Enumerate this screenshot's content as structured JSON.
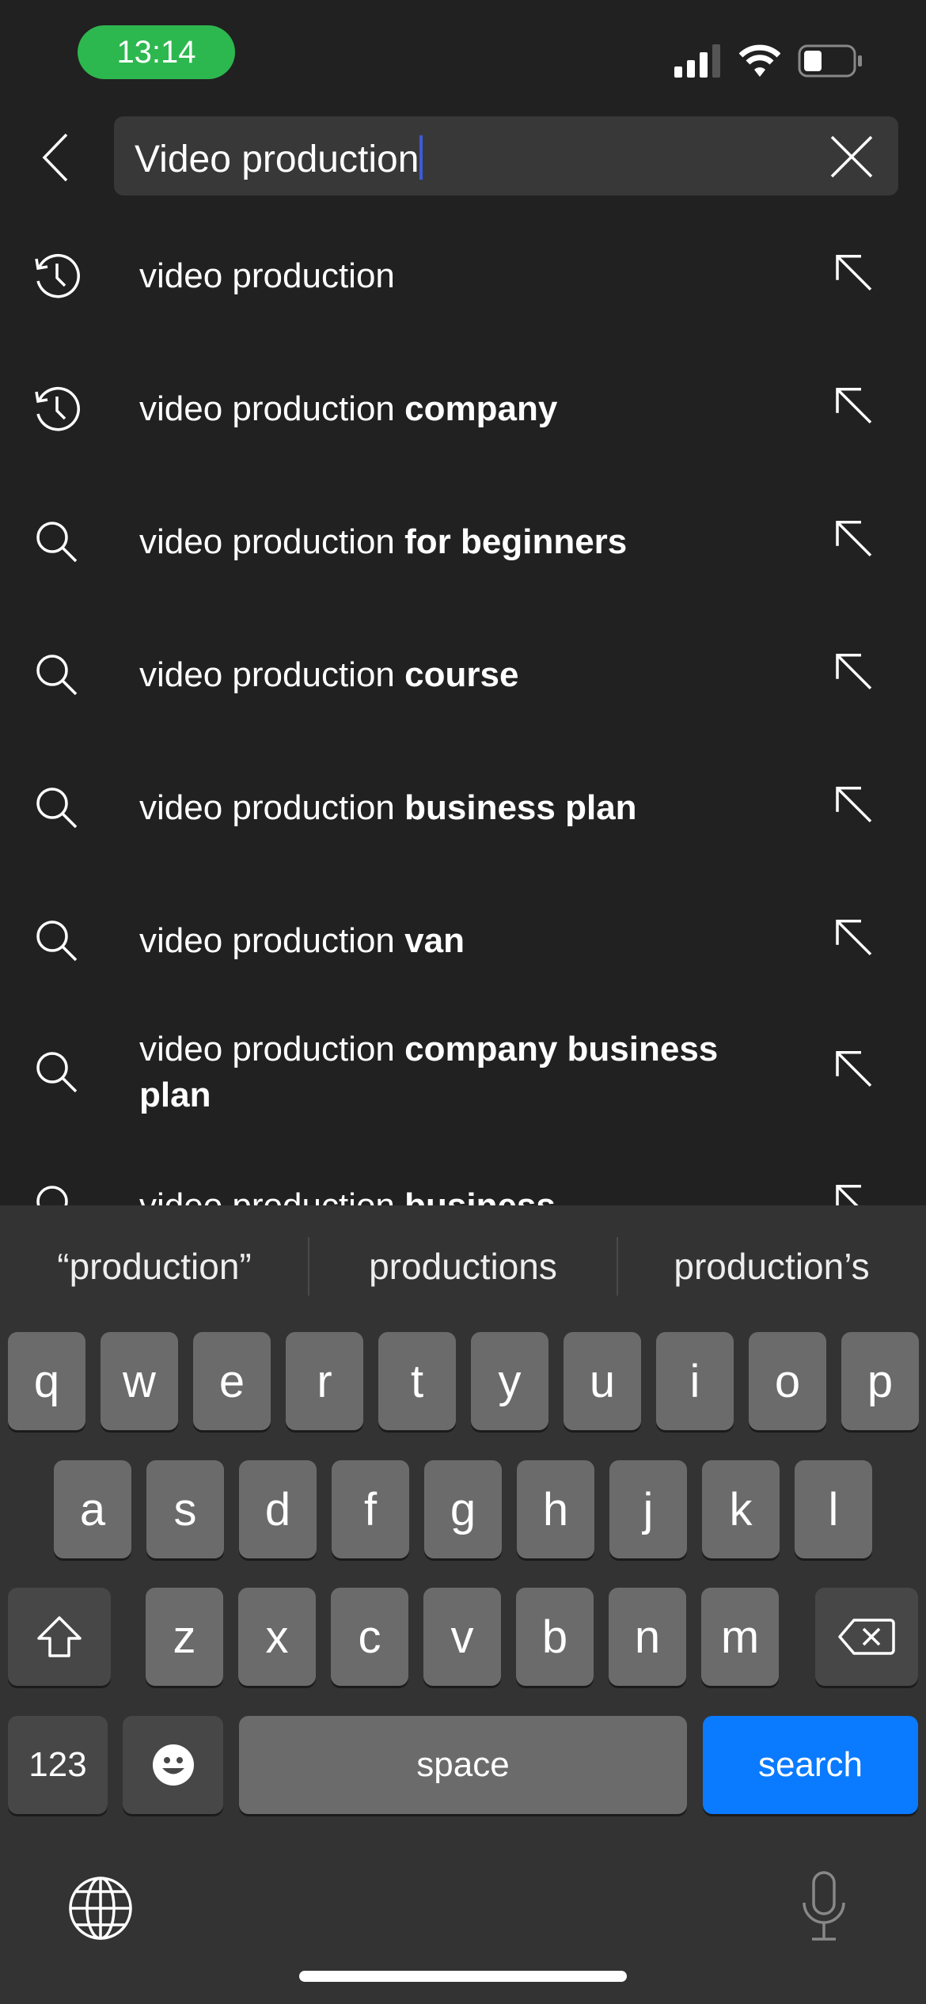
{
  "status_bar": {
    "time": "13:14",
    "signal_icon": "cellular-signal-icon",
    "wifi_icon": "wifi-icon",
    "battery_icon": "battery-icon",
    "time_pill_color": "#2db84f"
  },
  "search": {
    "back_icon": "chevron-left-icon",
    "query": "Video production",
    "clear_icon": "close-icon",
    "caret_color": "#3d5bd8"
  },
  "suggestions": [
    {
      "icon": "history-icon",
      "prefix": "video production",
      "bold": ""
    },
    {
      "icon": "history-icon",
      "prefix": "video production ",
      "bold": "company"
    },
    {
      "icon": "search-icon",
      "prefix": "video production ",
      "bold": "for beginners"
    },
    {
      "icon": "search-icon",
      "prefix": "video production ",
      "bold": "course"
    },
    {
      "icon": "search-icon",
      "prefix": "video production ",
      "bold": "business plan"
    },
    {
      "icon": "search-icon",
      "prefix": "video production ",
      "bold": "van"
    },
    {
      "icon": "search-icon",
      "prefix": "video production ",
      "bold": "company business plan"
    },
    {
      "icon": "search-icon",
      "prefix": "video production ",
      "bold": "business"
    }
  ],
  "keyboard": {
    "predictions": [
      "“production”",
      "productions",
      "production’s"
    ],
    "row1": [
      "q",
      "w",
      "e",
      "r",
      "t",
      "y",
      "u",
      "i",
      "o",
      "p"
    ],
    "row2": [
      "a",
      "s",
      "d",
      "f",
      "g",
      "h",
      "j",
      "k",
      "l"
    ],
    "row3": [
      "z",
      "x",
      "c",
      "v",
      "b",
      "n",
      "m"
    ],
    "numbers_label": "123",
    "space_label": "space",
    "search_label": "search",
    "search_color": "#0a7aff"
  }
}
